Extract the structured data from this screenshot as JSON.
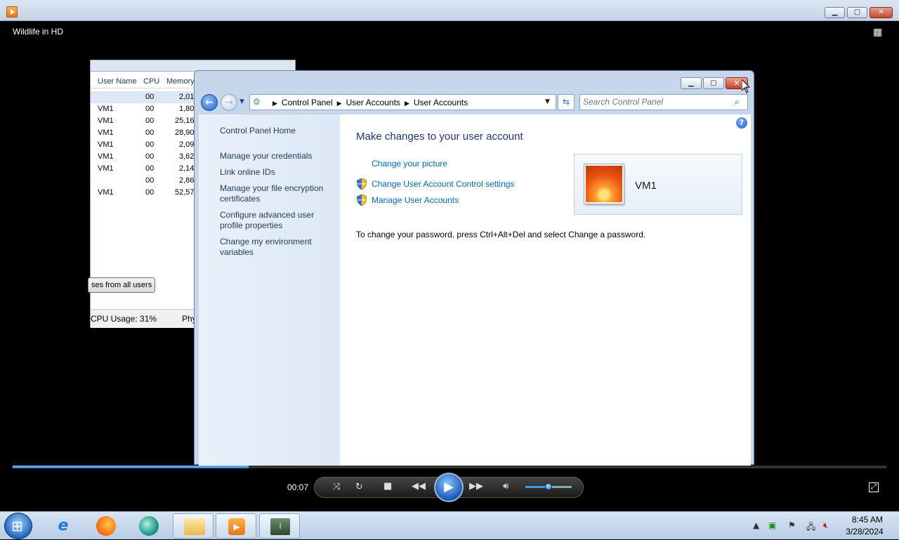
{
  "player": {
    "title": "Wildlife in HD",
    "time": "00:07",
    "progress": 0.27,
    "volume": 0.5
  },
  "taskmgr": {
    "columns": [
      "User Name",
      "CPU",
      "Memory"
    ],
    "rows": [
      {
        "user": "",
        "cpu": "00",
        "mem": "2,01"
      },
      {
        "user": "VM1",
        "cpu": "00",
        "mem": "1,80"
      },
      {
        "user": "VM1",
        "cpu": "00",
        "mem": "25,16"
      },
      {
        "user": "VM1",
        "cpu": "00",
        "mem": "28,90"
      },
      {
        "user": "VM1",
        "cpu": "00",
        "mem": "2,09"
      },
      {
        "user": "VM1",
        "cpu": "00",
        "mem": "3,62"
      },
      {
        "user": "VM1",
        "cpu": "00",
        "mem": "2,14"
      },
      {
        "user": "",
        "cpu": "00",
        "mem": "2,86"
      },
      {
        "user": "VM1",
        "cpu": "00",
        "mem": "52,57"
      }
    ],
    "show_all_button": "ses from all users",
    "cpu_usage": "CPU Usage: 31%",
    "phys": "Phy"
  },
  "cp": {
    "breadcrumb": [
      "Control Panel",
      "User Accounts",
      "User Accounts"
    ],
    "search_placeholder": "Search Control Panel",
    "left_links": {
      "home": "Control Panel Home",
      "credentials": "Manage your credentials",
      "online_ids": "Link online IDs",
      "encryption": "Manage your file encryption certificates",
      "profile": "Configure advanced user profile properties",
      "env": "Change my environment variables"
    },
    "heading": "Make changes to your user account",
    "tasks": {
      "picture": "Change your picture",
      "uac": "Change User Account Control settings",
      "manage": "Manage User Accounts"
    },
    "account_name": "VM1",
    "password_note": "To change your password, press Ctrl+Alt+Del and select Change a password."
  },
  "taskbar": {
    "time": "8:45 AM",
    "date": "3/28/2024"
  }
}
